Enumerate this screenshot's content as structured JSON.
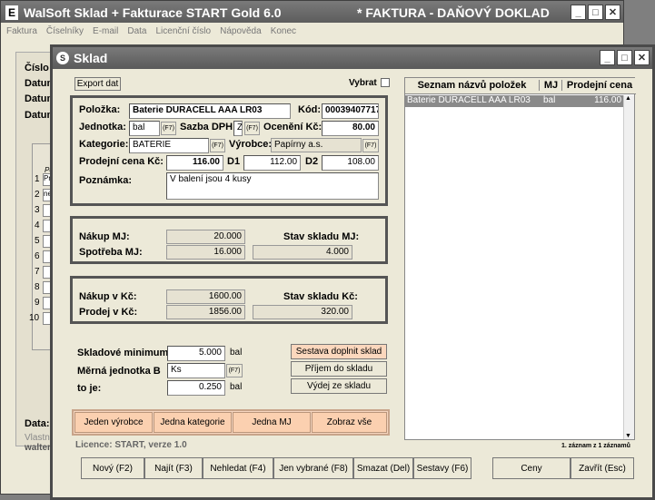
{
  "back_window": {
    "title": "WalSoft Sklad + Fakturace  START Gold 6.0",
    "subtitle": "*  FAKTURA - DAŇOVÝ DOKLAD",
    "menu": [
      "Faktura",
      "Číselníky",
      "E-mail",
      "Data",
      "Licenční číslo",
      "Nápověda",
      "Konec"
    ],
    "left_labels": [
      "Číslo f",
      "Datum",
      "Datum",
      "Datum"
    ],
    "row_numbers": [
      "1",
      "2",
      "3",
      "4",
      "5",
      "6",
      "7",
      "8",
      "9",
      "10"
    ],
    "row_values": [
      "Pr",
      "ne"
    ],
    "col_head": "Po",
    "data_label": "Data: H",
    "owner_label": "Vlastní",
    "owner_value": "walter"
  },
  "sklad": {
    "title": "Sklad",
    "export_label": "Export dat",
    "vybrat_label": "Vybrat",
    "polozka_label": "Položka:",
    "polozka_value": "Baterie DURACELL AAA LR03",
    "kod_label": "Kód:",
    "kod_value": "00039407717",
    "jednotka_label": "Jednotka:",
    "jednotka_value": "bal",
    "f7": "(F7)",
    "dph_label": "Sazba DPH:",
    "dph_value": "Z",
    "oceneni_label": "Ocenění Kč:",
    "oceneni_value": "80.00",
    "kategorie_label": "Kategorie:",
    "kategorie_value": "BATERIE",
    "vyrobce_label": "Výrobce:",
    "vyrobce_value": "Papírny a.s.",
    "prodejni_label": "Prodejní cena Kč: S",
    "prodejni_s": "116.00",
    "d1_label": "D1",
    "d1_value": "112.00",
    "d2_label": "D2",
    "d2_value": "108.00",
    "poznamka_label": "Poznámka:",
    "poznamka_value": "V balení jsou 4 kusy",
    "nakup_mj_label": "Nákup MJ:",
    "nakup_mj_value": "20.000",
    "spotreba_mj_label": "Spotřeba MJ:",
    "spotreba_mj_value": "16.000",
    "stav_mj_label": "Stav skladu MJ:",
    "stav_mj_value": "4.000",
    "nakup_kc_label": "Nákup v Kč:",
    "nakup_kc_value": "1600.00",
    "prodej_kc_label": "Prodej v Kč:",
    "prodej_kc_value": "1856.00",
    "stav_kc_label": "Stav skladu Kč:",
    "stav_kc_value": "320.00",
    "minimum_label": "Skladové minimum:",
    "minimum_value": "5.000",
    "minimum_unit": "bal",
    "merna_label": "Měrná jednotka B",
    "merna_value": "Ks",
    "toje_label": "to je:",
    "toje_value": "0.250",
    "toje_unit": "bal",
    "sestava_doplnit": "Sestava doplnit sklad",
    "prijem": "Příjem do skladu",
    "vydej": "Výdej ze skladu",
    "filters": [
      "Jeden výrobce",
      "Jedna kategorie",
      "Jedna MJ",
      "Zobraz vše"
    ],
    "licence": "Licence: START, verze 1.0",
    "list_headers": [
      "Seznam názvů položek",
      "MJ",
      "Prodejní cena"
    ],
    "list_rows": [
      {
        "name": "Baterie DURACELL AAA LR03",
        "mj": "bal",
        "price": "116.00"
      }
    ],
    "record_status": "1. záznam z 1 záznamů",
    "buttons": [
      "Nový (F2)",
      "Najít (F3)",
      "Nehledat (F4)",
      "Jen vybrané (F8)",
      "Smazat (Del)",
      "Sestavy (F6)",
      "Ceny",
      "Zavřít (Esc)"
    ]
  }
}
